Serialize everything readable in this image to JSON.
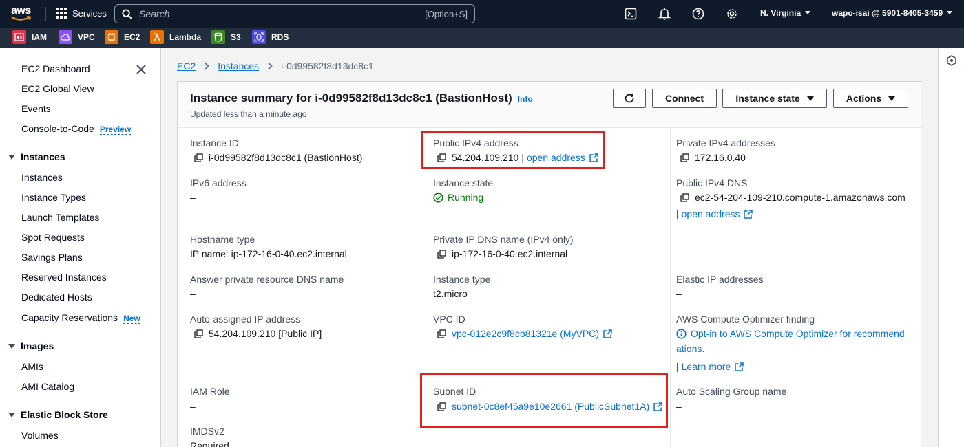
{
  "topnav": {
    "logo_text": "aws",
    "services_label": "Services",
    "search_placeholder": "Search",
    "search_shortcut": "[Option+S]",
    "icons": [
      "cloudshell-icon",
      "bell-icon",
      "help-icon",
      "gear-icon"
    ],
    "region": "N. Virginia",
    "account": "wapo-isai @ 5901-8405-3459"
  },
  "favorites": [
    {
      "label": "IAM",
      "color": "#dd344c"
    },
    {
      "label": "VPC",
      "color": "#8c4fff"
    },
    {
      "label": "EC2",
      "color": "#ed7100"
    },
    {
      "label": "Lambda",
      "color": "#ed7100"
    },
    {
      "label": "S3",
      "color": "#3f8624"
    },
    {
      "label": "RDS",
      "color": "#4d4ae0"
    }
  ],
  "sidebar": {
    "top_items": [
      {
        "label": "EC2 Dashboard"
      },
      {
        "label": "EC2 Global View"
      },
      {
        "label": "Events"
      },
      {
        "label": "Console-to-Code",
        "badge": "Preview"
      }
    ],
    "sections": [
      {
        "title": "Instances",
        "items": [
          "Instances",
          "Instance Types",
          "Launch Templates",
          "Spot Requests",
          "Savings Plans",
          "Reserved Instances",
          "Dedicated Hosts",
          "Capacity Reservations"
        ],
        "badge_item": "New"
      },
      {
        "title": "Images",
        "items": [
          "AMIs",
          "AMI Catalog"
        ]
      },
      {
        "title": "Elastic Block Store",
        "items": [
          "Volumes"
        ]
      }
    ]
  },
  "breadcrumb": [
    "EC2",
    "Instances",
    "i-0d99582f8d13dc8c1"
  ],
  "summary": {
    "title": "Instance summary for i-0d99582f8d13dc8c1 (BastionHost)",
    "info": "Info",
    "updated": "Updated less than a minute ago",
    "buttons": {
      "connect": "Connect",
      "instance_state": "Instance state",
      "actions": "Actions"
    }
  },
  "fields": {
    "instance_id": {
      "label": "Instance ID",
      "value": "i-0d99582f8d13dc8c1 (BastionHost)"
    },
    "ipv6": {
      "label": "IPv6 address",
      "value": "–"
    },
    "hostname_type": {
      "label": "Hostname type",
      "value": "IP name: ip-172-16-0-40.ec2.internal"
    },
    "answer_dns": {
      "label": "Answer private resource DNS name",
      "value": "–"
    },
    "auto_ip": {
      "label": "Auto-assigned IP address",
      "value": "54.204.109.210 [Public IP]"
    },
    "iam_role": {
      "label": "IAM Role",
      "value": "–"
    },
    "imdsv2": {
      "label": "IMDSv2",
      "value": "Required"
    },
    "public_ipv4": {
      "label": "Public IPv4 address",
      "value": "54.204.109.210",
      "sep": "|",
      "link": "open address"
    },
    "instance_state": {
      "label": "Instance state",
      "value": "Running"
    },
    "private_dns": {
      "label": "Private IP DNS name (IPv4 only)",
      "value": "ip-172-16-0-40.ec2.internal"
    },
    "instance_type": {
      "label": "Instance type",
      "value": "t2.micro"
    },
    "vpc_id": {
      "label": "VPC ID",
      "value": "vpc-012e2c9f8cb81321e (MyVPC)"
    },
    "subnet_id": {
      "label": "Subnet ID",
      "value": "subnet-0c8ef45a9e10e2661 (PublicSubnet1A)"
    },
    "private_ipv4": {
      "label": "Private IPv4 addresses",
      "value": "172.16.0.40"
    },
    "public_dns": {
      "label": "Public IPv4 DNS",
      "value": "ec2-54-204-109-210.compute-1.amazonaws.com",
      "sep": "|",
      "link": "open address"
    },
    "elastic_ip": {
      "label": "Elastic IP addresses",
      "value": "–"
    },
    "optimizer": {
      "label": "AWS Compute Optimizer finding",
      "line1": "Opt-in to AWS Compute Optimizer for recommend",
      "line2": "ations.",
      "sep": "|",
      "link": "Learn more"
    },
    "asg": {
      "label": "Auto Scaling Group name",
      "value": "–"
    }
  },
  "colors": {
    "highlight": "#e0201a",
    "link": "#0972d3",
    "success": "#037f0c"
  }
}
